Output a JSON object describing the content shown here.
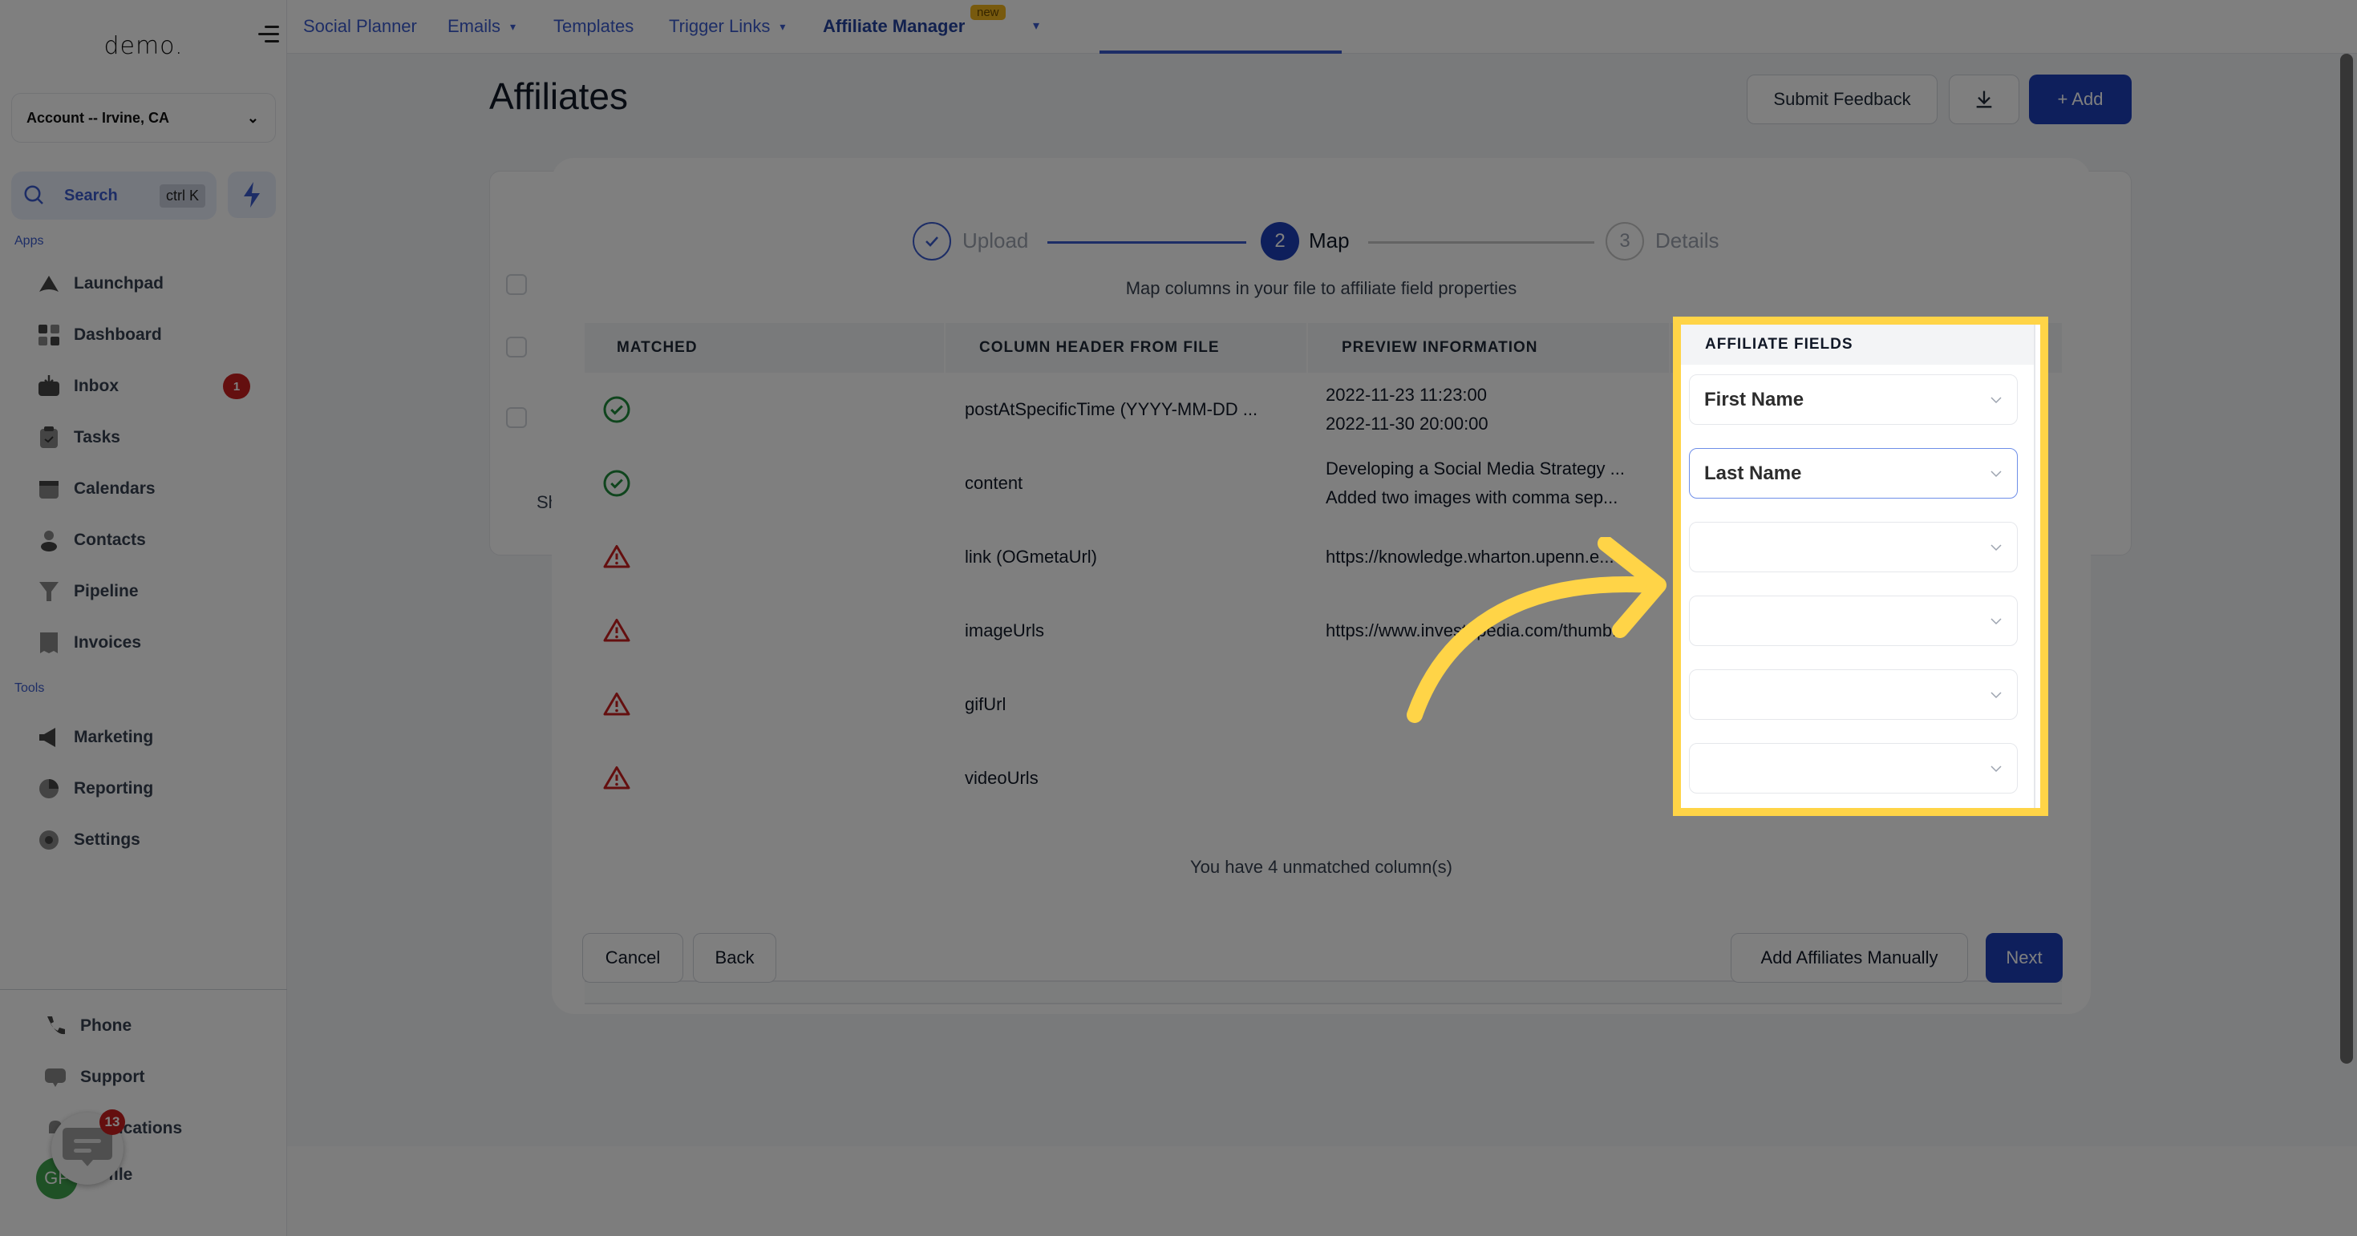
{
  "sidebar": {
    "logo": "demo.",
    "account": "Account -- Irvine, CA",
    "search_label": "Search",
    "search_shortcut": "ctrl K",
    "apps_label": "Apps",
    "tools_label": "Tools",
    "apps": [
      {
        "label": "Launchpad",
        "icon": "rocket-icon"
      },
      {
        "label": "Dashboard",
        "icon": "grid-icon"
      },
      {
        "label": "Inbox",
        "icon": "inbox-icon",
        "badge": "1"
      },
      {
        "label": "Tasks",
        "icon": "clipboard-check-icon"
      },
      {
        "label": "Calendars",
        "icon": "calendar-icon"
      },
      {
        "label": "Contacts",
        "icon": "person-icon"
      },
      {
        "label": "Pipeline",
        "icon": "funnel-icon"
      },
      {
        "label": "Invoices",
        "icon": "receipt-icon"
      }
    ],
    "tools": [
      {
        "label": "Marketing",
        "icon": "megaphone-icon"
      },
      {
        "label": "Reporting",
        "icon": "pie-chart-icon"
      },
      {
        "label": "Settings",
        "icon": "gear-icon"
      }
    ],
    "bottom": [
      {
        "label": "Phone",
        "icon": "phone-icon"
      },
      {
        "label": "Support",
        "icon": "chat-icon"
      },
      {
        "label": "Notifications",
        "icon": "bell-icon"
      },
      {
        "label": "Profile",
        "icon": "avatar"
      }
    ],
    "avatar_initials": "GP",
    "chat_widget_badge": "13"
  },
  "topbar": {
    "tabs": [
      {
        "label": "Social Planner",
        "dropdown": false
      },
      {
        "label": "Emails",
        "dropdown": true
      },
      {
        "label": "Templates",
        "dropdown": false
      },
      {
        "label": "Trigger Links",
        "dropdown": true
      },
      {
        "label": "Affiliate Manager",
        "dropdown": false,
        "active": true,
        "badge": "new"
      }
    ]
  },
  "page": {
    "title": "Affiliates",
    "submit_feedback": "Submit Feedback",
    "add_label": "+ Add",
    "background_partial_text": "Sh"
  },
  "modal": {
    "steps": [
      {
        "number": "1",
        "label": "Upload",
        "state": "done"
      },
      {
        "number": "2",
        "label": "Map",
        "state": "active"
      },
      {
        "number": "3",
        "label": "Details",
        "state": "pending"
      }
    ],
    "subtitle": "Map columns in your file to affiliate field properties",
    "columns": [
      "MATCHED",
      "COLUMN HEADER FROM FILE",
      "PREVIEW INFORMATION",
      "AFFILIATE FIELDS"
    ],
    "rows": [
      {
        "matched": true,
        "header": "postAtSpecificTime (YYYY-MM-DD ...",
        "preview": [
          "2022-11-23 11:23:00",
          "2022-11-30 20:00:00"
        ],
        "field": "First Name"
      },
      {
        "matched": true,
        "header": "content",
        "preview": [
          "Developing a Social Media Strategy ...",
          "Added two images with comma sep..."
        ],
        "field": "Last Name"
      },
      {
        "matched": false,
        "header": "link (OGmetaUrl)",
        "preview": [
          "https://knowledge.wharton.upenn.e..."
        ],
        "field": ""
      },
      {
        "matched": false,
        "header": "imageUrls",
        "preview": [
          "https://www.investopedia.com/thumb..."
        ],
        "field": ""
      },
      {
        "matched": false,
        "header": "gifUrl",
        "preview": [],
        "field": ""
      },
      {
        "matched": false,
        "header": "videoUrls",
        "preview": [],
        "field": ""
      }
    ],
    "unmatched_text": "You have 4 unmatched column(s)",
    "cancel": "Cancel",
    "back": "Back",
    "add_manually": "Add Affiliates Manually",
    "next": "Next"
  },
  "colors": {
    "primary": "#1d3fb8",
    "highlight": "#ffd447",
    "success": "#1f8a3a",
    "warning": "#c81e1e"
  }
}
